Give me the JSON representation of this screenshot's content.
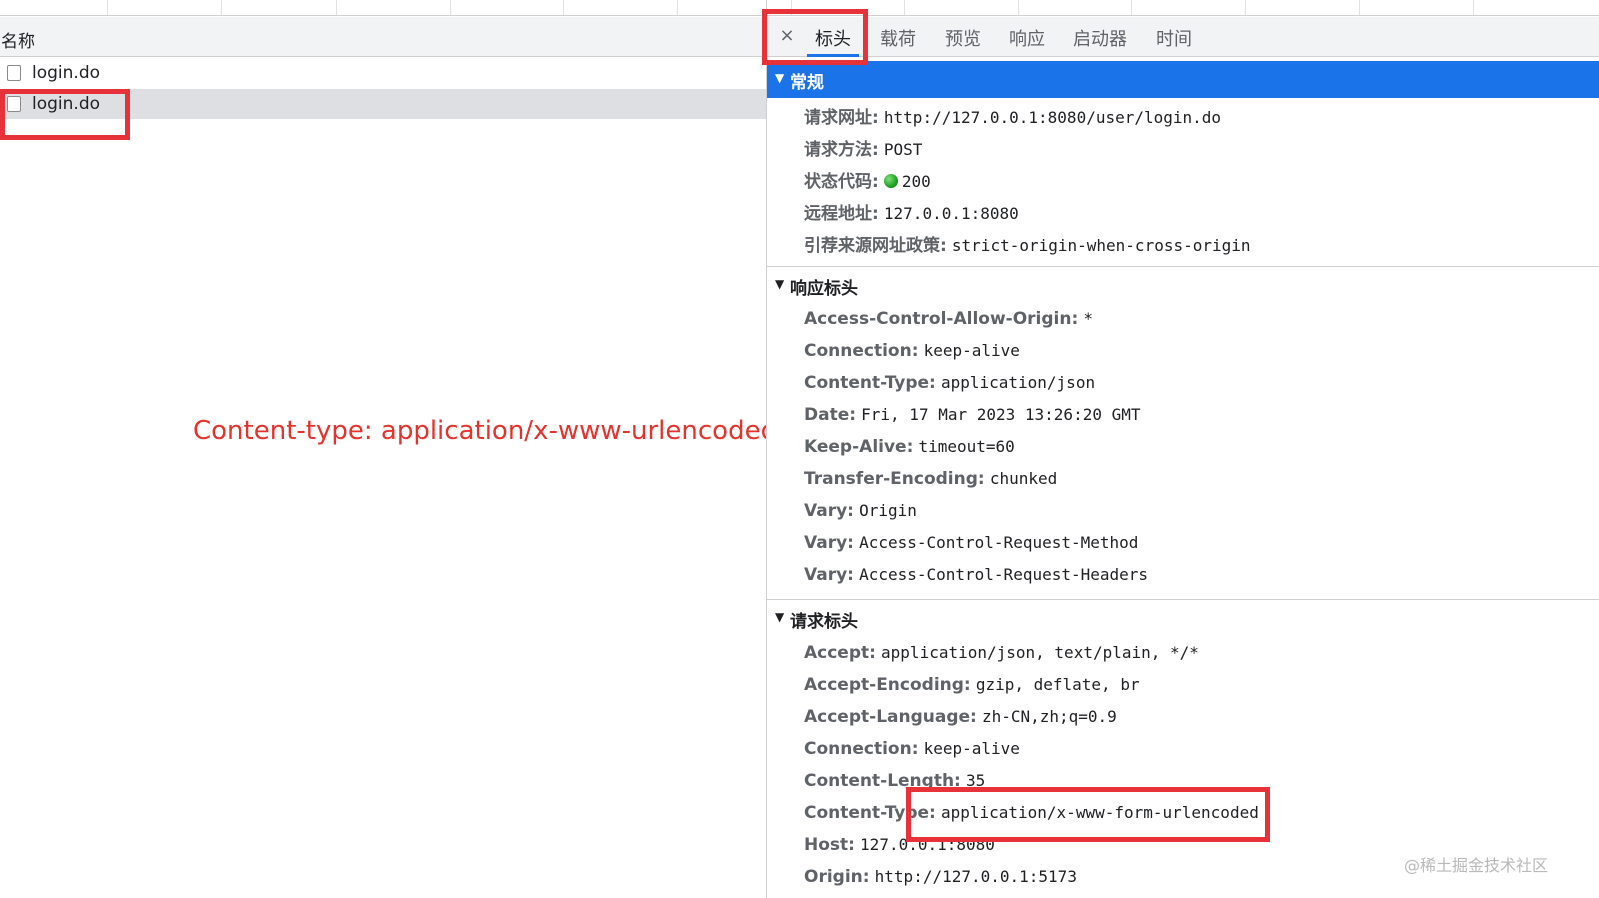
{
  "requests_panel": {
    "column_header": "名称",
    "requests": [
      {
        "name": "login.do"
      },
      {
        "name": "login.do"
      }
    ]
  },
  "annotation": "Content-type: application/x-www-urlencoded",
  "details_panel": {
    "close_icon": "close-icon",
    "close_glyph": "×",
    "tabs": [
      {
        "label": "标头",
        "active": true
      },
      {
        "label": "载荷"
      },
      {
        "label": "预览"
      },
      {
        "label": "响应"
      },
      {
        "label": "启动器"
      },
      {
        "label": "时间"
      }
    ],
    "general": {
      "title": "常规",
      "rows": [
        {
          "key": "请求网址:",
          "value": "http://127.0.0.1:8080/user/login.do"
        },
        {
          "key": "请求方法:",
          "value": "POST"
        },
        {
          "key": "状态代码:",
          "value": "200"
        },
        {
          "key": "远程地址:",
          "value": "127.0.0.1:8080"
        },
        {
          "key": "引荐来源网址政策:",
          "value": "strict-origin-when-cross-origin"
        }
      ]
    },
    "response_headers": {
      "title": "响应标头",
      "rows": [
        {
          "key": "Access-Control-Allow-Origin:",
          "value": "*"
        },
        {
          "key": "Connection:",
          "value": "keep-alive"
        },
        {
          "key": "Content-Type:",
          "value": "application/json"
        },
        {
          "key": "Date:",
          "value": "Fri, 17 Mar 2023 13:26:20 GMT"
        },
        {
          "key": "Keep-Alive:",
          "value": "timeout=60"
        },
        {
          "key": "Transfer-Encoding:",
          "value": "chunked"
        },
        {
          "key": "Vary:",
          "value": "Origin"
        },
        {
          "key": "Vary:",
          "value": "Access-Control-Request-Method"
        },
        {
          "key": "Vary:",
          "value": "Access-Control-Request-Headers"
        }
      ]
    },
    "request_headers": {
      "title": "请求标头",
      "rows": [
        {
          "key": "Accept:",
          "value": "application/json, text/plain, */*"
        },
        {
          "key": "Accept-Encoding:",
          "value": "gzip, deflate, br"
        },
        {
          "key": "Accept-Language:",
          "value": "zh-CN,zh;q=0.9"
        },
        {
          "key": "Connection:",
          "value": "keep-alive"
        },
        {
          "key": "Content-Length:",
          "value": "35"
        },
        {
          "key": "Content-Type:",
          "value": "application/x-www-form-urlencoded"
        },
        {
          "key": "Host:",
          "value": "127.0.0.1:8080"
        },
        {
          "key": "Origin:",
          "value": "http://127.0.0.1:5173"
        }
      ]
    }
  },
  "watermark": "@稀土掘金技术社区",
  "colors": {
    "accent": "#1a73e8",
    "highlight_box": "#e8323a",
    "annotation": "#e5322d",
    "status_ok": "#1ea01e"
  }
}
